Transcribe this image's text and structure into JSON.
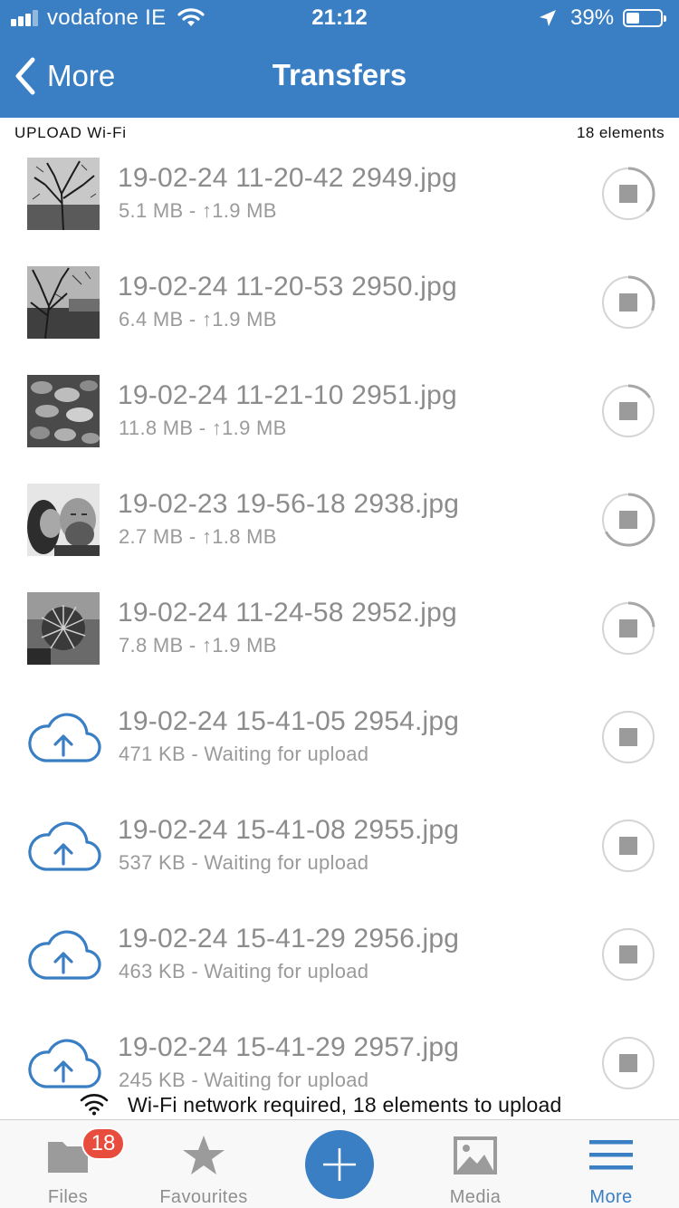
{
  "status_bar": {
    "carrier": "vodafone IE",
    "time": "21:12",
    "battery": "39%",
    "battery_level": 0.39
  },
  "nav": {
    "back_label": "More",
    "title": "Transfers"
  },
  "section": {
    "title": "UPLOAD Wi-Fi",
    "count": "18 elements"
  },
  "transfers": [
    {
      "name": "19-02-24 11-20-42 2949.jpg",
      "meta": "5.1 MB - ↑1.9 MB",
      "thumb": "tree",
      "progress": 0.37
    },
    {
      "name": "19-02-24 11-20-53 2950.jpg",
      "meta": "6.4 MB - ↑1.9 MB",
      "thumb": "branches",
      "progress": 0.3
    },
    {
      "name": "19-02-24 11-21-10 2951.jpg",
      "meta": "11.8 MB - ↑1.9 MB",
      "thumb": "leaves",
      "progress": 0.16
    },
    {
      "name": "19-02-23 19-56-18 2938.jpg",
      "meta": "2.7 MB - ↑1.8 MB",
      "thumb": "people",
      "progress": 0.67
    },
    {
      "name": "19-02-24 11-24-58 2952.jpg",
      "meta": "7.8 MB - ↑1.9 MB",
      "thumb": "plant",
      "progress": 0.24
    },
    {
      "name": "19-02-24 15-41-05 2954.jpg",
      "meta": "471 KB - Waiting for upload",
      "thumb": "cloud-upload-icon",
      "progress": 0
    },
    {
      "name": "19-02-24 15-41-08 2955.jpg",
      "meta": "537 KB - Waiting for upload",
      "thumb": "cloud-upload-icon",
      "progress": 0
    },
    {
      "name": "19-02-24 15-41-29 2956.jpg",
      "meta": "463 KB - Waiting for upload",
      "thumb": "cloud-upload-icon",
      "progress": 0
    },
    {
      "name": "19-02-24 15-41-29 2957.jpg",
      "meta": "245 KB - Waiting for upload",
      "thumb": "cloud-upload-icon",
      "progress": 0
    }
  ],
  "notice": {
    "text": "Wi-Fi network required, 18 elements to upload"
  },
  "tabs": [
    {
      "label": "Files",
      "icon": "folder-icon",
      "badge": "18"
    },
    {
      "label": "Favourites",
      "icon": "star-icon"
    },
    {
      "label": "",
      "icon": "plus-icon"
    },
    {
      "label": "Media",
      "icon": "image-icon"
    },
    {
      "label": "More",
      "icon": "menu-icon",
      "active": true
    }
  ],
  "colors": {
    "accent": "#3a7fc4",
    "text_muted": "#8c8c8c",
    "badge": "#e74c3c"
  }
}
